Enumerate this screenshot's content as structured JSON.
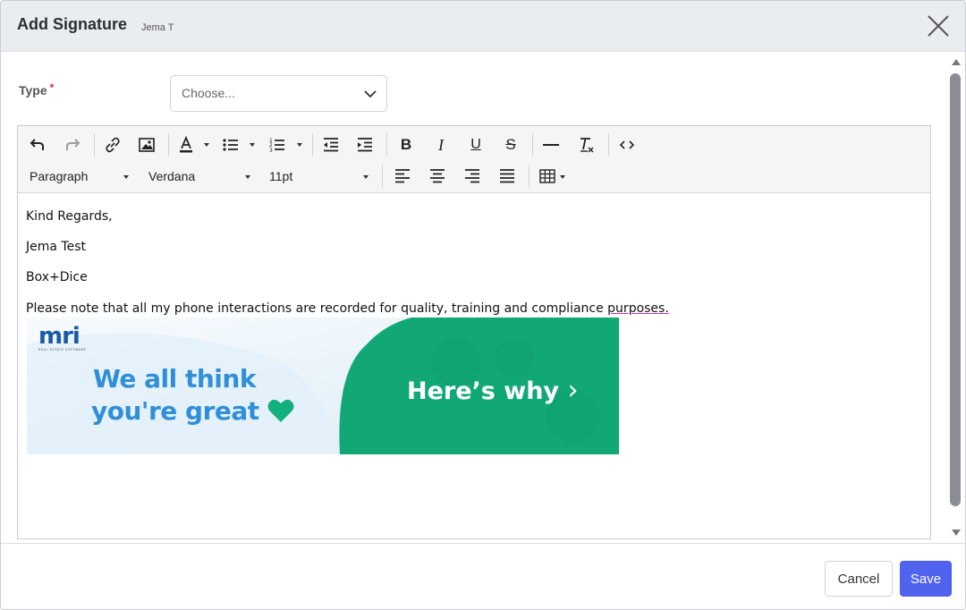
{
  "header": {
    "title": "Add Signature",
    "subtitle": "Jema T"
  },
  "form": {
    "type_label": "Type",
    "required_mark": "*",
    "type_placeholder": "Choose..."
  },
  "toolbar": {
    "block_format": "Paragraph",
    "font_family": "Verdana",
    "font_size": "11pt",
    "icons": [
      "undo-icon",
      "redo-icon",
      "link-icon",
      "image-icon",
      "text-color-icon",
      "bullet-list-icon",
      "numbered-list-icon",
      "outdent-icon",
      "indent-icon",
      "bold-icon",
      "italic-icon",
      "underline-icon",
      "strikethrough-icon",
      "horizontal-line-icon",
      "clear-formatting-icon",
      "source-code-icon",
      "align-left-icon",
      "align-center-icon",
      "align-right-icon",
      "align-justify-icon",
      "table-icon"
    ]
  },
  "content": {
    "line1": "Kind Regards,",
    "line2": "Jema Test",
    "line3": "Box+Dice",
    "line4_main": "Please note that all my phone interactions are recorded for quality, training and compliance ",
    "line4_end": "purposes.",
    "banner": {
      "logo": "mri",
      "logo_tagline": "REAL ESTATE SOFTWARE",
      "headline1": "We all think",
      "headline2": "you're great",
      "cta": "Here’s why",
      "cta_arrow": "›",
      "colors": {
        "blue": "#2f8fd8",
        "green": "#12b07c",
        "light_bg": "#e6f2fb"
      }
    }
  },
  "footer": {
    "cancel_label": "Cancel",
    "save_label": "Save"
  },
  "colors": {
    "header_bg": "#e9ecf0",
    "primary": "#5063ee",
    "required": "#e0263b"
  }
}
